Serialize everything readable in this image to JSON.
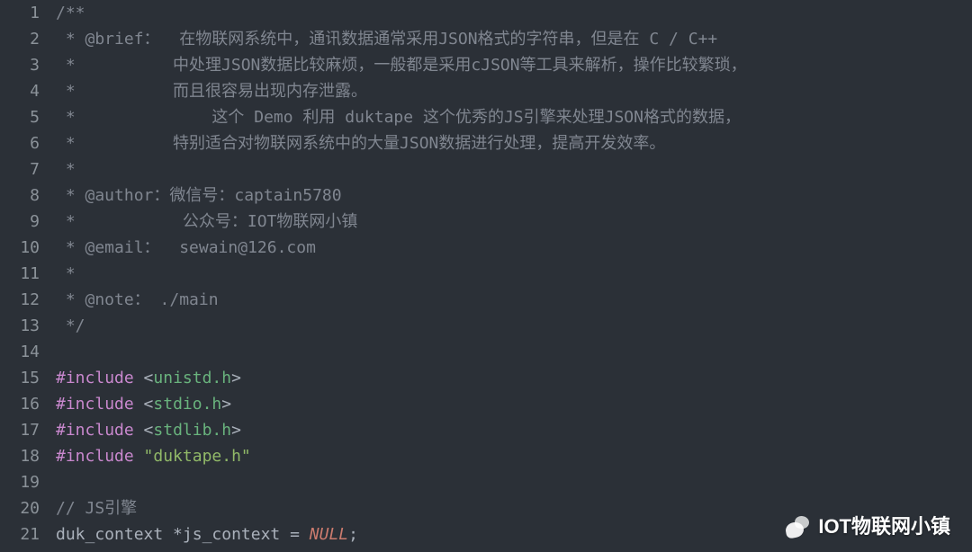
{
  "lines": [
    {
      "num": 1,
      "tokens": [
        {
          "cls": "comment",
          "t": "/**"
        }
      ]
    },
    {
      "num": 2,
      "tokens": [
        {
          "cls": "comment",
          "t": " * @brief：  在物联网系统中，通讯数据通常采用JSON格式的字符串，但是在 C / C++"
        }
      ]
    },
    {
      "num": 3,
      "tokens": [
        {
          "cls": "comment",
          "t": " *          中处理JSON数据比较麻烦，一般都是采用cJSON等工具来解析，操作比较繁琐，"
        }
      ]
    },
    {
      "num": 4,
      "tokens": [
        {
          "cls": "comment",
          "t": " *          而且很容易出现内存泄露。"
        }
      ]
    },
    {
      "num": 5,
      "tokens": [
        {
          "cls": "comment",
          "t": " *              这个 Demo 利用 duktape 这个优秀的JS引擎来处理JSON格式的数据，"
        }
      ]
    },
    {
      "num": 6,
      "tokens": [
        {
          "cls": "comment",
          "t": " *          特别适合对物联网系统中的大量JSON数据进行处理，提高开发效率。"
        }
      ]
    },
    {
      "num": 7,
      "tokens": [
        {
          "cls": "comment",
          "t": " *"
        }
      ]
    },
    {
      "num": 8,
      "tokens": [
        {
          "cls": "comment",
          "t": " * @author：微信号：captain5780"
        }
      ]
    },
    {
      "num": 9,
      "tokens": [
        {
          "cls": "comment",
          "t": " *           公众号：IOT物联网小镇"
        }
      ]
    },
    {
      "num": 10,
      "tokens": [
        {
          "cls": "comment",
          "t": " * @email：  sewain@126.com"
        }
      ]
    },
    {
      "num": 11,
      "tokens": [
        {
          "cls": "comment",
          "t": " *"
        }
      ]
    },
    {
      "num": 12,
      "tokens": [
        {
          "cls": "comment",
          "t": " * @note： ./main"
        }
      ]
    },
    {
      "num": 13,
      "tokens": [
        {
          "cls": "comment",
          "t": " */"
        }
      ]
    },
    {
      "num": 14,
      "tokens": []
    },
    {
      "num": 15,
      "tokens": [
        {
          "cls": "preproc-hash",
          "t": "#"
        },
        {
          "cls": "preproc-kw",
          "t": "include"
        },
        {
          "cls": "",
          "t": " "
        },
        {
          "cls": "include-br",
          "t": "<"
        },
        {
          "cls": "include-hdr",
          "t": "unistd.h"
        },
        {
          "cls": "include-br",
          "t": ">"
        }
      ]
    },
    {
      "num": 16,
      "tokens": [
        {
          "cls": "preproc-hash",
          "t": "#"
        },
        {
          "cls": "preproc-kw",
          "t": "include"
        },
        {
          "cls": "",
          "t": " "
        },
        {
          "cls": "include-br",
          "t": "<"
        },
        {
          "cls": "include-hdr",
          "t": "stdio.h"
        },
        {
          "cls": "include-br",
          "t": ">"
        }
      ]
    },
    {
      "num": 17,
      "tokens": [
        {
          "cls": "preproc-hash",
          "t": "#"
        },
        {
          "cls": "preproc-kw",
          "t": "include"
        },
        {
          "cls": "",
          "t": " "
        },
        {
          "cls": "include-br",
          "t": "<"
        },
        {
          "cls": "include-hdr",
          "t": "stdlib.h"
        },
        {
          "cls": "include-br",
          "t": ">"
        }
      ]
    },
    {
      "num": 18,
      "tokens": [
        {
          "cls": "preproc-hash",
          "t": "#"
        },
        {
          "cls": "preproc-kw",
          "t": "include"
        },
        {
          "cls": "",
          "t": " "
        },
        {
          "cls": "string",
          "t": "\"duktape.h\""
        }
      ]
    },
    {
      "num": 19,
      "tokens": []
    },
    {
      "num": 20,
      "tokens": [
        {
          "cls": "comment",
          "t": "// JS引擎"
        }
      ]
    },
    {
      "num": 21,
      "tokens": [
        {
          "cls": "ident",
          "t": "duk_context "
        },
        {
          "cls": "op",
          "t": "*"
        },
        {
          "cls": "ident",
          "t": "js_context "
        },
        {
          "cls": "op",
          "t": "= "
        },
        {
          "cls": "null-kw",
          "t": "NULL"
        },
        {
          "cls": "op",
          "t": ";"
        }
      ]
    }
  ],
  "watermark": {
    "label": "IOT物联网小镇"
  }
}
